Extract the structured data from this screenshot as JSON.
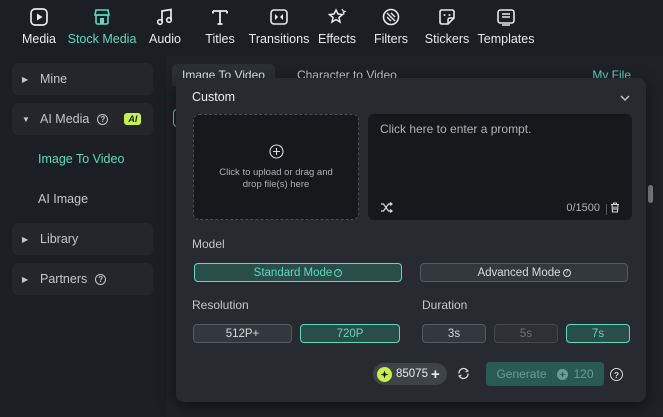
{
  "toolbar": {
    "items": [
      {
        "label": "Media",
        "icon": "media-icon"
      },
      {
        "label": "Stock Media",
        "icon": "stock-media-icon"
      },
      {
        "label": "Audio",
        "icon": "audio-icon"
      },
      {
        "label": "Titles",
        "icon": "titles-icon"
      },
      {
        "label": "Transitions",
        "icon": "transitions-icon"
      },
      {
        "label": "Effects",
        "icon": "effects-icon"
      },
      {
        "label": "Filters",
        "icon": "filters-icon"
      },
      {
        "label": "Stickers",
        "icon": "stickers-icon"
      },
      {
        "label": "Templates",
        "icon": "templates-icon"
      }
    ],
    "active": "Stock Media"
  },
  "sidebar": {
    "items": [
      {
        "label": "Mine"
      },
      {
        "label": "AI Media",
        "badge": "AI"
      },
      {
        "label": "Image To Video"
      },
      {
        "label": "AI Image"
      },
      {
        "label": "Library"
      },
      {
        "label": "Partners"
      }
    ]
  },
  "main": {
    "tabs": [
      {
        "label": "Image To Video"
      },
      {
        "label": "Character to Video"
      }
    ],
    "my_file": "My File"
  },
  "panel": {
    "title": "Custom",
    "upload_text": "Click to upload or drag and drop file(s) here",
    "prompt_placeholder": "Click here to enter a prompt.",
    "char_count": "0/1500",
    "model_label": "Model",
    "modes": [
      "Standard Mode",
      "Advanced Mode"
    ],
    "resolution_label": "Resolution",
    "resolutions": [
      "512P+",
      "720P"
    ],
    "duration_label": "Duration",
    "durations": [
      "3s",
      "5s",
      "7s"
    ],
    "credits": "85075",
    "generate_label": "Generate",
    "generate_cost": "120"
  },
  "colors": {
    "accent": "#5fd9c0",
    "badge": "#c6f04b",
    "background": "#1b1e22",
    "panel": "#272b30"
  }
}
